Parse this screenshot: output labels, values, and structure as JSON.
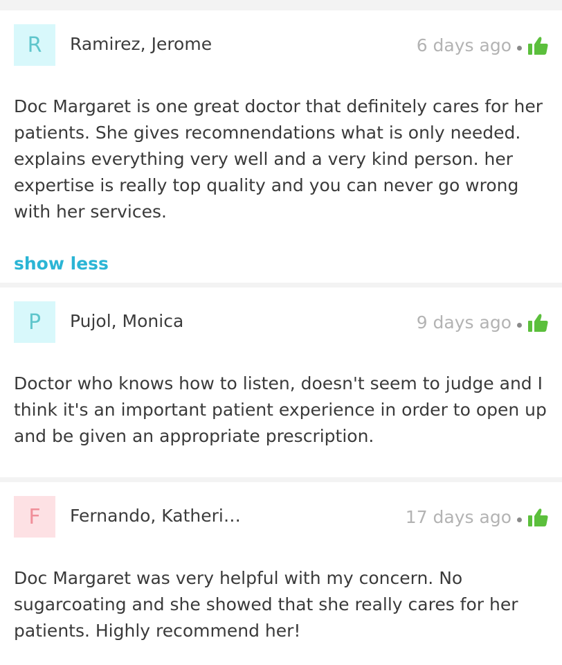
{
  "reviews": [
    {
      "initial": "R",
      "name": "Ramirez, Jerome",
      "time": "6 days ago",
      "text": "Doc Margaret is one great doctor that definitely cares for her patients. She gives recomnendations what is only needed. explains everything very well and a very kind person. her expertise is really top quality and you can never go wrong with her services.",
      "toggle": "show less"
    },
    {
      "initial": "P",
      "name": "Pujol, Monica",
      "time": "9 days ago",
      "text": "Doctor who knows how to listen, doesn't seem to judge and I think it's an important patient experience in order to open up and be given an appropriate prescription."
    },
    {
      "initial": "F",
      "name": "Fernando, Katheri…",
      "time": "17 days ago",
      "text": "Doc Margaret was very helpful with my concern. No sugarcoating and she showed that she really cares for her patients. Highly recommend her!"
    }
  ],
  "colors": {
    "accent": "#2bb5d5",
    "like": "#5bbf3c",
    "avatar_teal_bg": "#d8f8fb",
    "avatar_pink_bg": "#fde1e4"
  },
  "icons": {
    "like": "thumbs-up-icon"
  }
}
